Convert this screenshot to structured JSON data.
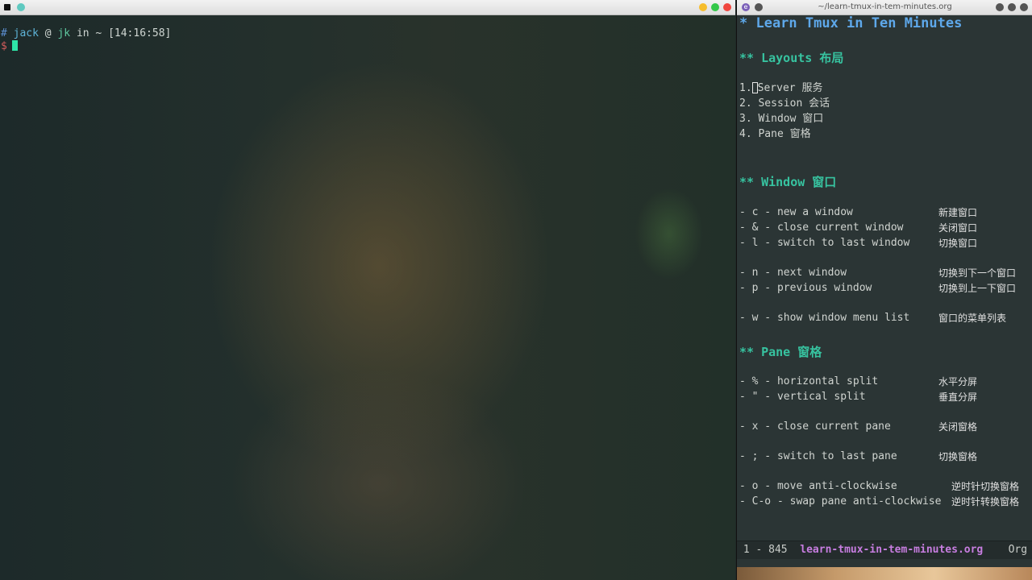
{
  "terminal": {
    "prompt": {
      "hash": "#",
      "user": "jack",
      "at": "@",
      "host": "jk",
      "in": "in",
      "dir": "~",
      "time": "[14:16:58]",
      "dollar": "$"
    }
  },
  "editor": {
    "title": "~/learn-tmux-in-tem-minutes.org",
    "icon_letter": "e",
    "heading": "* Learn Tmux in Ten Minutes",
    "sections": {
      "layouts": {
        "heading": "** Layouts 布局",
        "items": [
          {
            "num": "1.",
            "text": "Server 服务"
          },
          {
            "num": "2.",
            "text": "Session 会话"
          },
          {
            "num": "3.",
            "text": "Window 窗口"
          },
          {
            "num": "4.",
            "text": "Pane 窗格"
          }
        ]
      },
      "window": {
        "heading": "** Window 窗口",
        "items": [
          {
            "cmd": "- c - new a window",
            "zh": "新建窗口"
          },
          {
            "cmd": "- & - close current window",
            "zh": "关闭窗口"
          },
          {
            "cmd": "- l - switch to last window",
            "zh": "切换窗口"
          },
          {
            "cmd": "- n - next window",
            "zh": "切换到下一个窗口"
          },
          {
            "cmd": "- p - previous window",
            "zh": "切换到上一下窗口"
          },
          {
            "cmd": "- w - show window menu list",
            "zh": "窗口的菜单列表"
          }
        ]
      },
      "pane": {
        "heading": "** Pane 窗格",
        "items": [
          {
            "cmd": "- % - horizontal split",
            "zh": "水平分屏"
          },
          {
            "cmd": "- \" - vertical split",
            "zh": "垂直分屏"
          },
          {
            "cmd": "- x - close current pane",
            "zh": "关闭窗格"
          },
          {
            "cmd": "- ; - switch to last pane",
            "zh": "切换窗格"
          },
          {
            "cmd": "- o - move anti-clockwise",
            "zh": "逆时针切换窗格"
          },
          {
            "cmd": "- C-o - swap pane anti-clockwise",
            "zh": "逆时针转换窗格"
          }
        ]
      }
    },
    "modeline": {
      "position": "1 - 845",
      "filename": "learn-tmux-in-tem-minutes.org",
      "mode": "Org"
    }
  },
  "colors": {
    "heading1": "#5ea8ea",
    "heading2": "#37c3a0",
    "modeline_file": "#c77de0",
    "cursor": "#2ee6a8"
  }
}
